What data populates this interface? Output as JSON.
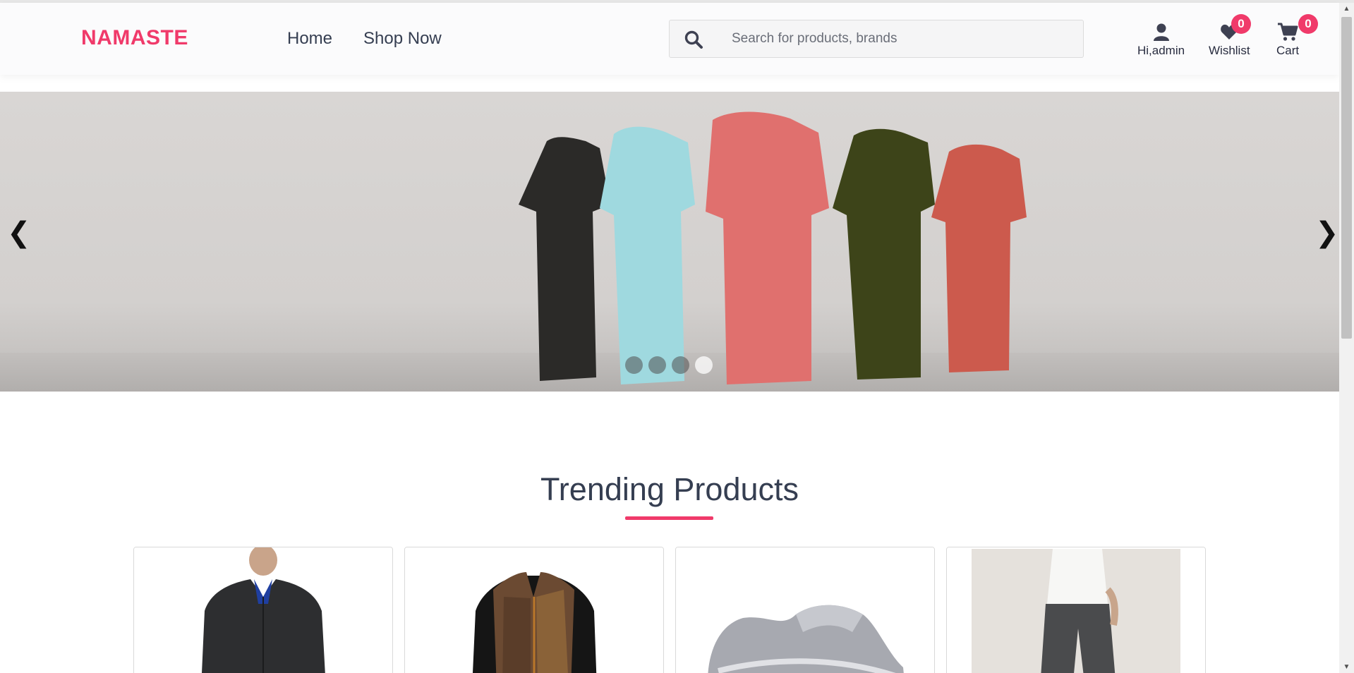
{
  "header": {
    "logo": "NAMASTE",
    "nav": [
      "Home",
      "Shop Now"
    ],
    "search_placeholder": "Search for products, brands",
    "profile_label": "Hi,admin",
    "wishlist_label": "Wishlist",
    "wishlist_count": "0",
    "cart_label": "Cart",
    "cart_count": "0"
  },
  "carousel": {
    "prev_arrow": "❮",
    "next_arrow": "❯",
    "slides_count": 4,
    "active_slide": 4,
    "shirt_colors": [
      "#2b2a28",
      "#9fd9df",
      "#e0706e",
      "#3d4419",
      "#cc5a4d"
    ]
  },
  "trending": {
    "title": "Trending Products",
    "accent_color": "#f03a6a",
    "products": [
      {
        "image": "black zip jacket"
      },
      {
        "image": "brown vest"
      },
      {
        "image": "grey sneaker"
      },
      {
        "image": "grey trousers"
      }
    ]
  },
  "colors": {
    "brand": "#f03a6a",
    "text": "#353e51"
  },
  "icons": {
    "search": "search-icon",
    "profile": "user-icon",
    "wishlist": "heart-icon",
    "cart": "cart-icon"
  }
}
